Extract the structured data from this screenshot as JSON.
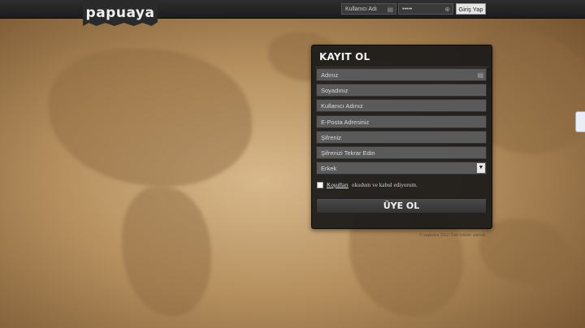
{
  "brand": {
    "logo_text": "papuaya"
  },
  "header": {
    "username_placeholder": "Kullanıcı Adı",
    "password_value": "•••••",
    "login_button": "Giriş Yap"
  },
  "register": {
    "title": "KAYIT OL",
    "fields": [
      "Adınız",
      "Soyadınız",
      "Kullanıcı Adınız",
      "E-Posta Adresiniz",
      "Şifreniz",
      "Şifrenizi Tekrar Edin"
    ],
    "gender_selected": "Erkek",
    "terms_link": "Koşulları",
    "terms_text": "okudum ve kabul ediyorum.",
    "submit_label": "ÜYE OL"
  },
  "footer": {
    "note": "© papuaya 2012 Tüm hakları saklıdır."
  },
  "colors": {
    "accent": "#1c1c1c",
    "background": "#c6a474"
  },
  "icons": [
    "user-icon",
    "lock-icon",
    "chevron-down-icon"
  ]
}
